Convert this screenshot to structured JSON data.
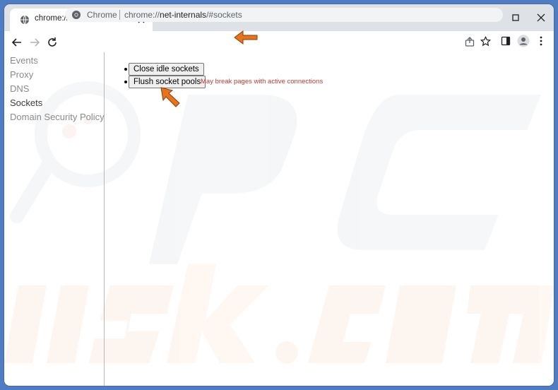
{
  "tab": {
    "title": "chrome://net-internals/#sockets"
  },
  "omnibox": {
    "chip": "Chrome",
    "url_prefix": "chrome://",
    "url_host": "net-internals",
    "url_path": "/#sockets"
  },
  "sidebar": {
    "items": [
      {
        "label": "Events"
      },
      {
        "label": "Proxy"
      },
      {
        "label": "DNS"
      },
      {
        "label": "Sockets"
      },
      {
        "label": "Domain Security Policy"
      }
    ],
    "active_index": 3
  },
  "main": {
    "close_idle_label": "Close idle sockets",
    "flush_label": "Flush socket pools",
    "flush_warning": "May break pages with active connections"
  },
  "colors": {
    "desktop": "#4f7cc2",
    "tabstrip": "#dee1e6",
    "warning": "#c0392b",
    "annotation_arrow": "#e8731d"
  },
  "icons": [
    "globe-icon",
    "close-icon",
    "plus-icon",
    "minimize-icon",
    "chevron-down-icon",
    "maximize-icon",
    "back-icon",
    "forward-icon",
    "reload-icon",
    "chrome-icon",
    "share-icon",
    "star-icon",
    "side-panel-icon",
    "profile-icon",
    "more-icon"
  ]
}
